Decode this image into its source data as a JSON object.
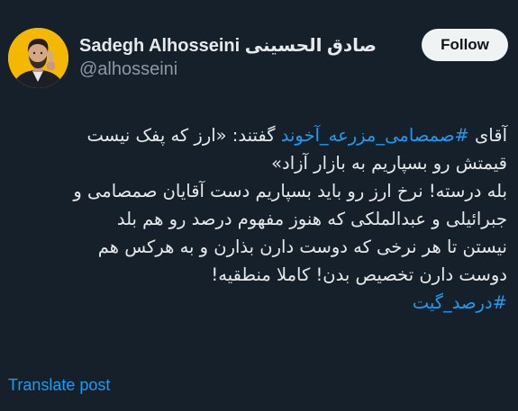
{
  "user": {
    "display_name": "Sadegh Alhosseini صادق الحسینی",
    "handle": "@alhosseini",
    "avatar": "profile-photo"
  },
  "follow_button": {
    "label": "Follow"
  },
  "tweet": {
    "line1_prefix": "آقای ",
    "line1_hashtag": "#صمصامی_مزرعه_آخوند",
    "line1_suffix": " گفتند: «ارز که پفک نیست",
    "line2": "قیمتش رو بسپاریم به بازار آزاد»",
    "line3": "بله درسته! نرخ ارز رو باید بسپاریم دست آقایان صمصامی و",
    "line4": "جبرائیلی و عبدالملکی که هنوز مفهوم درصد رو هم بلد",
    "line5": "نیستن تا هر نرخی که دوست دارن بذارن و به هرکس هم",
    "line6": "دوست دارن تخصیص بدن! کاملا منطقیه!",
    "line7_hashtag": "#درصد_گیت"
  },
  "translate_link": "Translate post",
  "colors": {
    "background": "#15202b",
    "text": "#e7e9ea",
    "secondary": "#8b98a5",
    "link": "#1d9bf0",
    "button_bg": "#eff3f4",
    "avatar_bg": "#f5b800"
  }
}
